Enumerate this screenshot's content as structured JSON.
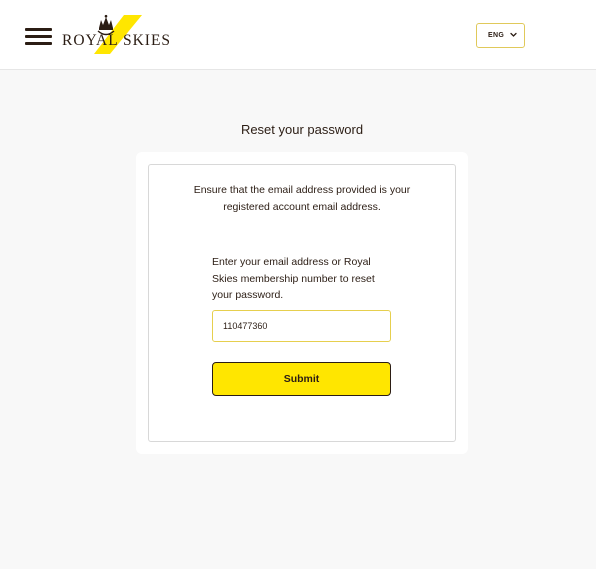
{
  "header": {
    "brand_name": "ROYAL SKIES",
    "language": {
      "selected": "ENG"
    }
  },
  "page": {
    "title": "Reset your password"
  },
  "form": {
    "intro_text": "Ensure that the email address provided is your registered account email address.",
    "field_label": "Enter your email address or Royal Skies membership number to reset your password.",
    "field_value": "110477360",
    "submit_label": "Submit"
  },
  "icons": {
    "menu": "hamburger-menu-icon",
    "logo": "crown-crest-logo",
    "language_dropdown": "chevron-down-icon"
  },
  "colors": {
    "accent_yellow": "#ffe600",
    "brand_dark": "#2b1d14",
    "input_border": "#e6cf4e",
    "page_background": "#f8f8f8"
  }
}
